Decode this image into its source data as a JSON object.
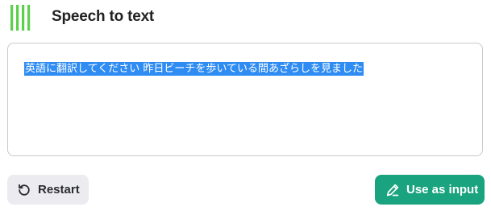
{
  "app": {
    "title": "Speech to text",
    "accent_color": "#19a37f",
    "logo_color": "#5bd04b"
  },
  "transcript": {
    "text": "英語に翻訳してください 昨日ビーチを歩いている間あざらしを見ました",
    "selected": true
  },
  "buttons": {
    "restart": {
      "label": "Restart",
      "icon": "restart-icon"
    },
    "use_as_input": {
      "label": "Use as input",
      "icon": "pencil-icon"
    }
  }
}
